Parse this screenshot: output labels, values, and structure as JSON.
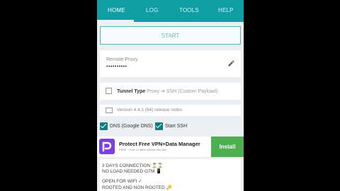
{
  "tabs": [
    {
      "label": "HOME"
    },
    {
      "label": "LOG"
    },
    {
      "label": "TOOLS"
    },
    {
      "label": "HELP"
    }
  ],
  "start_label": "START",
  "proxy": {
    "label": "Remote Proxy",
    "value": "••••••••••"
  },
  "tunnel": {
    "label": "Tunnel Type",
    "value": "Proxy ➔ SSH (Custom Payload)"
  },
  "version_text": "Version 4.4.1 (94) release notes",
  "checkboxes": [
    {
      "label": "DNS (Google DNS)",
      "checked": true
    },
    {
      "label": "Start SSH",
      "checked": true
    }
  ],
  "ad": {
    "title": "Protect Free VPN+Data Manager",
    "subtitle": "FREE · Over 1 million people use this",
    "install_label": "Install",
    "icon": "p-logo-icon"
  },
  "info_lines": [
    "3 DAYS CONNECTION ⏳⌛",
    "NO LOAD NEEDED GTM 📱",
    "OPEN FOR WIFI ✓",
    "ROOTED AND NON ROOTED 🔑"
  ],
  "colors": {
    "accent": "#0f9ea3",
    "checkbox": "#0b7d83",
    "install": "#4caf50",
    "ad_icon": "#7b3fe4"
  }
}
